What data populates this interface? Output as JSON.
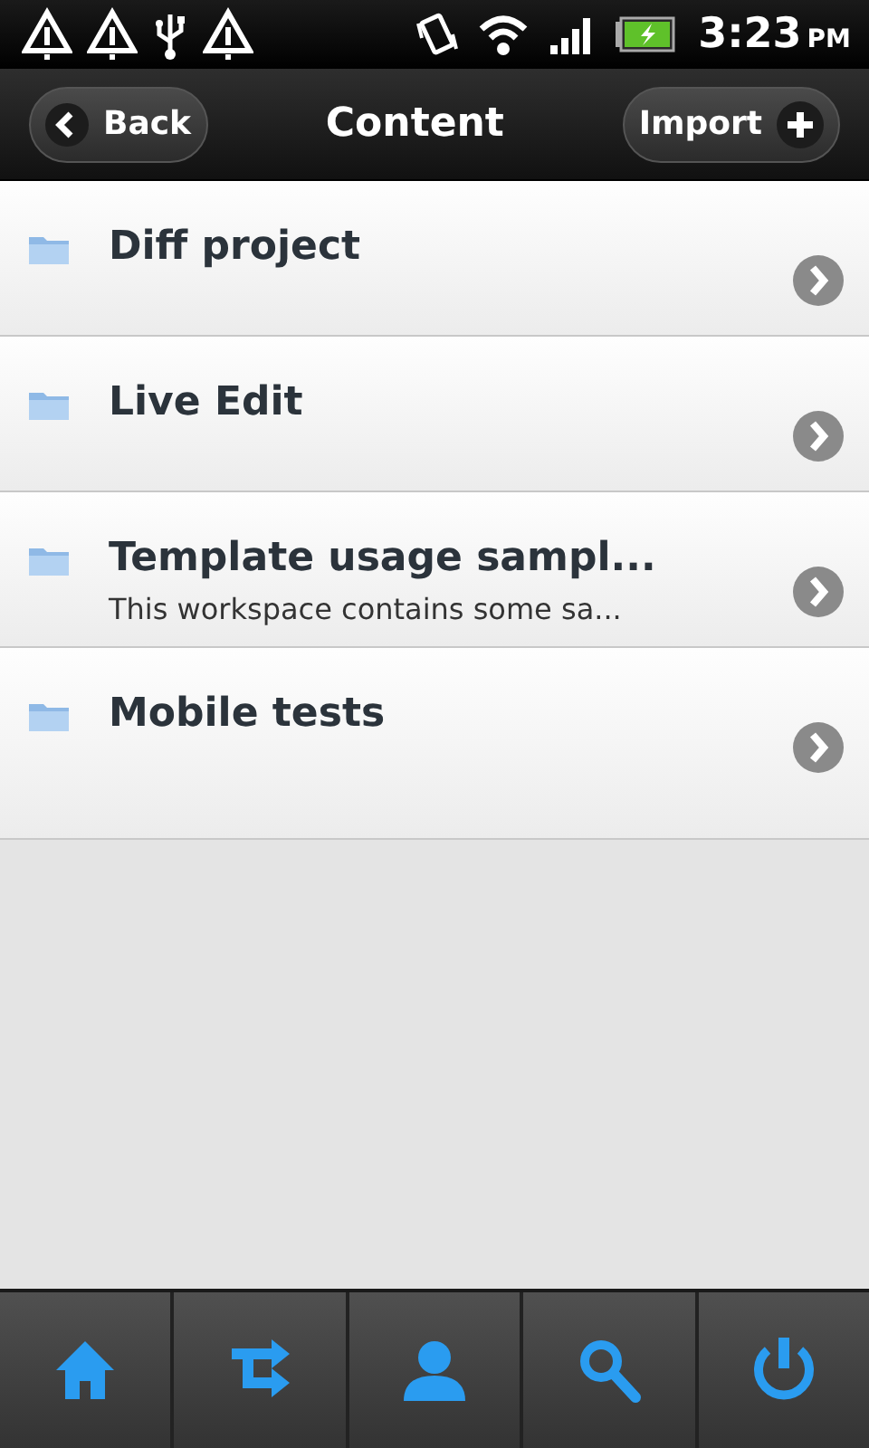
{
  "status_bar": {
    "time": "3:23",
    "ampm": "PM"
  },
  "header": {
    "back": "Back",
    "title": "Content",
    "import": "Import"
  },
  "items": [
    {
      "title": "Diff project"
    },
    {
      "title": "Live Edit"
    },
    {
      "title": "Template usage sampl...",
      "subtitle": "This workspace contains some sa..."
    },
    {
      "title": "Mobile tests"
    }
  ]
}
